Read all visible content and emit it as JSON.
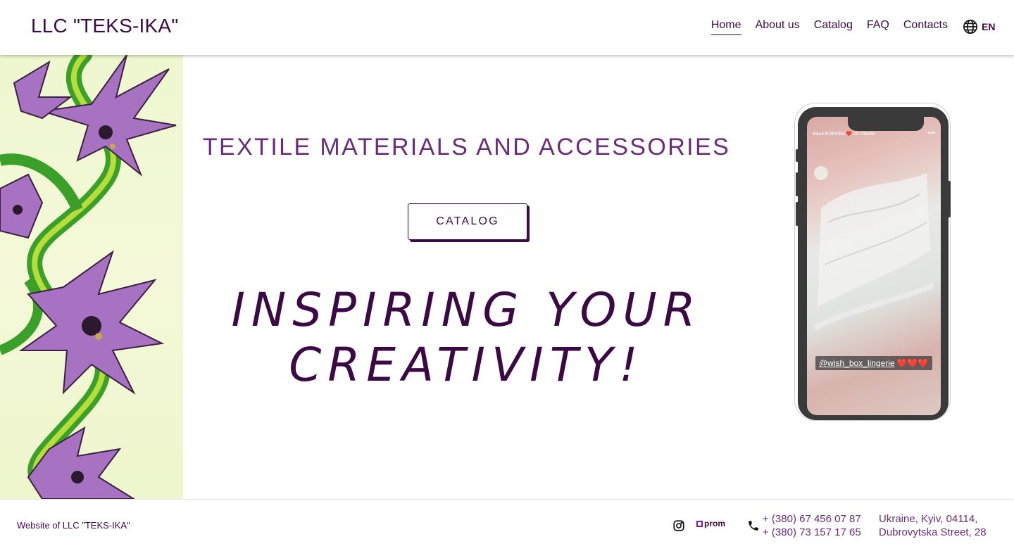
{
  "header": {
    "logo": "LLC \"TEKS-IKA\"",
    "nav": [
      {
        "label": "Home",
        "active": true
      },
      {
        "label": "About us",
        "active": false
      },
      {
        "label": "Catalog",
        "active": false
      },
      {
        "label": "FAQ",
        "active": false
      },
      {
        "label": "Contacts",
        "active": false
      }
    ],
    "language": {
      "icon": "globe-icon",
      "code": "EN"
    }
  },
  "hero": {
    "title": "TEXTILE MATERIALS AND ACCESSORIES",
    "button_label": "CATALOG",
    "tagline_line1": "INSPIRING YOUR",
    "tagline_line2": "CREATIVITY!"
  },
  "phone_mockup": {
    "story_header": "Ваші ВИРОБИ❤️  20 тижнів",
    "tag_handle": "@wish_box_lingerie",
    "tag_hearts": "❤️❤️❤️"
  },
  "footer": {
    "site_label": "Website of LLC \"TEKS-IKA\"",
    "social": [
      {
        "icon": "instagram-icon"
      },
      {
        "icon": "prom-logo",
        "label": "prom"
      }
    ],
    "phone_icon": "phone-icon",
    "phones": [
      "+ (380) 67 456 07 87",
      "+ (380) 73 157 17 65"
    ],
    "address_line1": "Ukraine, Kyiv, 04114,",
    "address_line2": "Dubrovytska Street, 28"
  },
  "colors": {
    "primary": "#3b0a45",
    "accent": "#6a2d7a",
    "prom_brand": "#7b1fa2"
  }
}
